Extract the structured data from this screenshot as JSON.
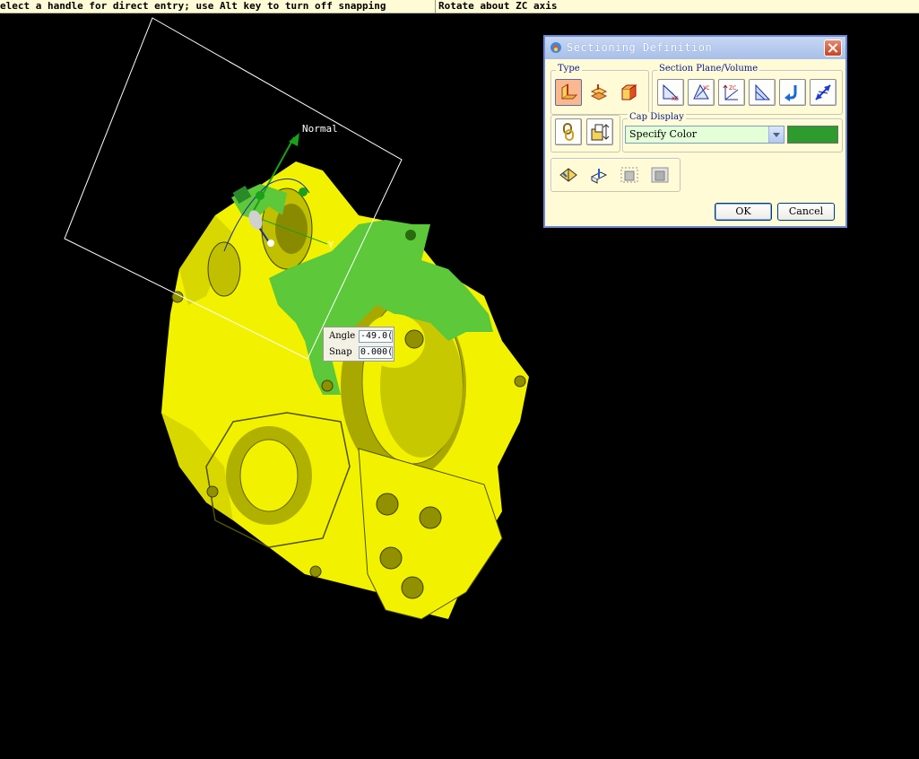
{
  "status_bar": {
    "prompt": "elect a handle for direct entry; use Alt key to turn off snapping",
    "hint": "Rotate about ZC axis"
  },
  "viewport": {
    "handle_label": "Normal",
    "axis_y_label": "Y",
    "angle_label": "Angle",
    "angle_value": "-49.0(",
    "snap_label": "Snap",
    "snap_value": "0.000("
  },
  "dialog": {
    "title": "Sectioning Definition",
    "type_label": "Type",
    "section_plane_label": "Section Plane/Volume",
    "cap_display_label": "Cap Display",
    "cap_display_value": "Specify Color",
    "ok_label": "OK",
    "cancel_label": "Cancel",
    "cap_color": "#2d9b2d",
    "plane_axis_labels": [
      "XC",
      "YC",
      "ZC"
    ]
  },
  "colors": {
    "part": "#f2f200",
    "section": "#5cc83a",
    "background": "#000000"
  }
}
